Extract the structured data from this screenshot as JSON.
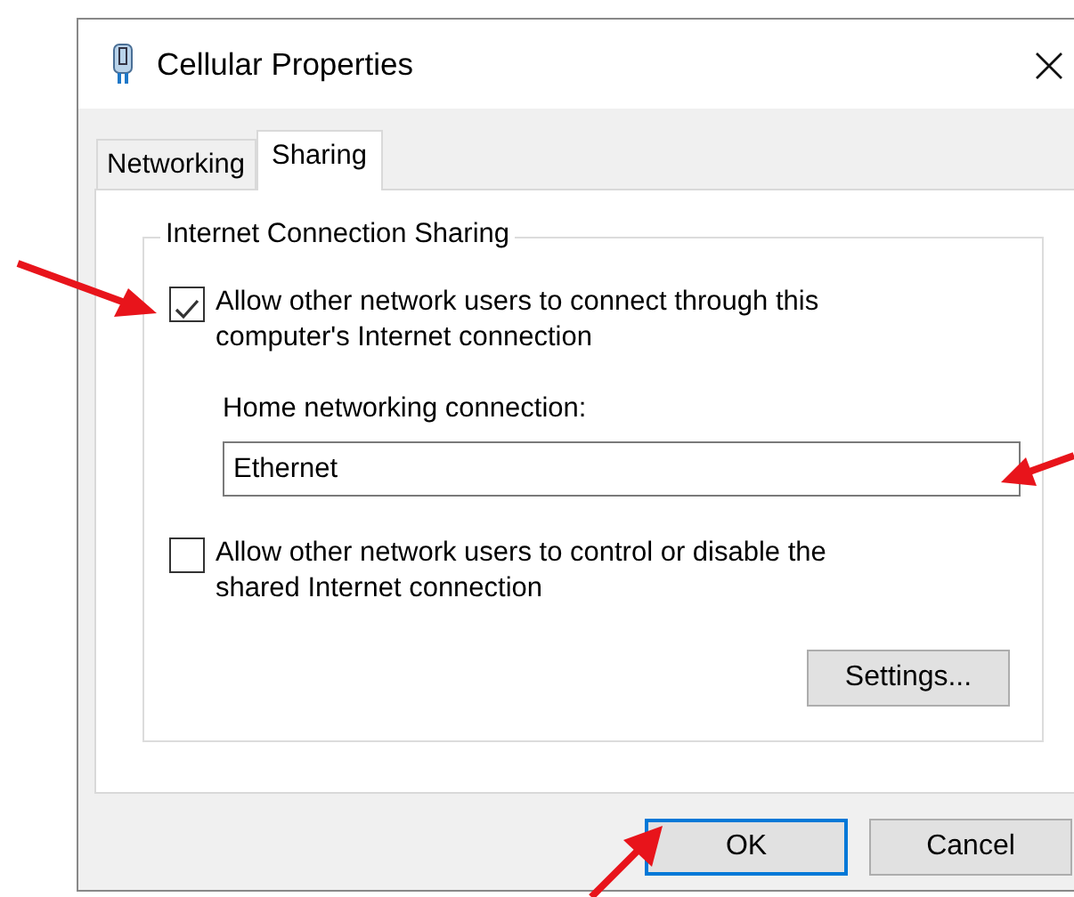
{
  "window": {
    "title": "Cellular Properties"
  },
  "tabs": [
    {
      "label": "Networking",
      "selected": false
    },
    {
      "label": "Sharing",
      "selected": true
    }
  ],
  "group": {
    "title": "Internet Connection Sharing",
    "options": [
      {
        "label": "Allow other network users to connect through this computer's Internet connection",
        "checked": true
      },
      {
        "label": "Allow other network users to control or disable the shared Internet connection",
        "checked": false
      }
    ],
    "home_connection": {
      "label": "Home networking connection:",
      "value": "Ethernet"
    },
    "settings_button": "Settings..."
  },
  "buttons": [
    {
      "label": "OK",
      "is_default": true
    },
    {
      "label": "Cancel",
      "is_default": false
    }
  ]
}
